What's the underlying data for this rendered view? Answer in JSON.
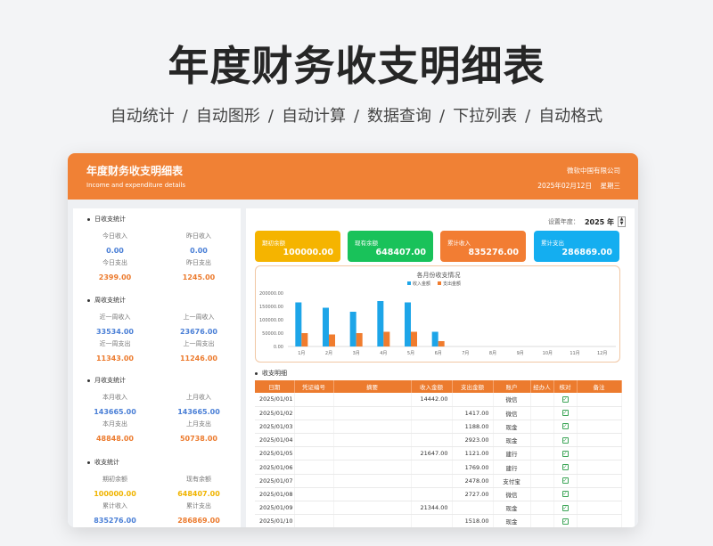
{
  "hero": {
    "title": "年度财务收支明细表",
    "features": [
      "自动统计",
      "自动图形",
      "自动计算",
      "数据查询",
      "下拉列表",
      "自动格式"
    ]
  },
  "header": {
    "title": "年度财务收支明细表",
    "subtitle": "Income and expenditure details",
    "company": "微软中国有限公司",
    "date": "2025年02月12日    星期三"
  },
  "colors": {
    "header_orange": "#f08135",
    "income_blue": "#1da5e8",
    "expense_orange": "#f07c2e",
    "opening_gold": "#f5b400",
    "balance_green": "#19c25a",
    "total_income_orange": "#f27d33",
    "total_expense_blue": "#14aef0"
  },
  "left": {
    "sections": [
      {
        "title": "日收支统计",
        "cells": [
          {
            "label": "今日收入",
            "value": "0.00",
            "color": "blue"
          },
          {
            "label": "昨日收入",
            "value": "0.00",
            "color": "blue"
          },
          {
            "label": "今日支出",
            "value": "2399.00",
            "color": "orange"
          },
          {
            "label": "昨日支出",
            "value": "1245.00",
            "color": "orange"
          }
        ]
      },
      {
        "title": "周收支统计",
        "cells": [
          {
            "label": "近一周收入",
            "value": "33534.00",
            "color": "blue"
          },
          {
            "label": "上一周收入",
            "value": "23676.00",
            "color": "blue"
          },
          {
            "label": "近一周支出",
            "value": "11343.00",
            "color": "orange"
          },
          {
            "label": "上一周支出",
            "value": "11246.00",
            "color": "orange"
          }
        ]
      },
      {
        "title": "月收支统计",
        "cells": [
          {
            "label": "本月收入",
            "value": "143665.00",
            "color": "blue"
          },
          {
            "label": "上月收入",
            "value": "143665.00",
            "color": "blue"
          },
          {
            "label": "本月支出",
            "value": "48848.00",
            "color": "orange"
          },
          {
            "label": "上月支出",
            "value": "50738.00",
            "color": "orange"
          }
        ]
      },
      {
        "title": "收支统计",
        "cells": [
          {
            "label": "期初余额",
            "value": "100000.00",
            "color": "gold"
          },
          {
            "label": "现有余额",
            "value": "648407.00",
            "color": "gold"
          },
          {
            "label": "累计收入",
            "value": "835276.00",
            "color": "blue"
          },
          {
            "label": "累计支出",
            "value": "286869.00",
            "color": "orange"
          }
        ]
      }
    ]
  },
  "year_setter": {
    "label": "设置年度：",
    "value": "2025 年",
    "up": "▲",
    "down": "▼"
  },
  "summary": [
    {
      "label": "期初余额",
      "value": "100000.00",
      "color": "#f5b400"
    },
    {
      "label": "现有余额",
      "value": "648407.00",
      "color": "#19c25a"
    },
    {
      "label": "累计收入",
      "value": "835276.00",
      "color": "#f27d33"
    },
    {
      "label": "累计支出",
      "value": "286869.00",
      "color": "#14aef0"
    }
  ],
  "chart_data": {
    "type": "bar",
    "title": "各月份收支情况",
    "categories": [
      "1月",
      "2月",
      "3月",
      "4月",
      "5月",
      "6月",
      "7月",
      "8月",
      "9月",
      "10月",
      "11月",
      "12月"
    ],
    "series": [
      {
        "name": "收入金额",
        "color": "#1da5e8",
        "values": [
          165000,
          145000,
          130000,
          170000,
          165000,
          55000,
          0,
          0,
          0,
          0,
          0,
          0
        ]
      },
      {
        "name": "支出金额",
        "color": "#f07c2e",
        "values": [
          50000,
          45000,
          50000,
          55000,
          55000,
          20000,
          0,
          0,
          0,
          0,
          0,
          0
        ]
      }
    ],
    "yticks": [
      "0.00",
      "50000.00",
      "100000.00",
      "150000.00",
      "200000.00"
    ],
    "ylim": [
      0,
      200000
    ],
    "legend": "top-center",
    "grid": false
  },
  "detail": {
    "title": "收支明细",
    "columns": [
      "日期",
      "凭证编号",
      "摘要",
      "收入金额",
      "支出金额",
      "账户",
      "经办人",
      "核对",
      "备注"
    ],
    "rows": [
      {
        "date": "2025/01/01",
        "income": "14442.00",
        "expense": "",
        "account": "微信"
      },
      {
        "date": "2025/01/02",
        "income": "",
        "expense": "1417.00",
        "account": "微信"
      },
      {
        "date": "2025/01/03",
        "income": "",
        "expense": "1188.00",
        "account": "现金"
      },
      {
        "date": "2025/01/04",
        "income": "",
        "expense": "2923.00",
        "account": "现金"
      },
      {
        "date": "2025/01/05",
        "income": "21647.00",
        "expense": "1121.00",
        "account": "建行"
      },
      {
        "date": "2025/01/06",
        "income": "",
        "expense": "1769.00",
        "account": "建行"
      },
      {
        "date": "2025/01/07",
        "income": "",
        "expense": "2478.00",
        "account": "支付宝"
      },
      {
        "date": "2025/01/08",
        "income": "",
        "expense": "2727.00",
        "account": "微信"
      },
      {
        "date": "2025/01/09",
        "income": "21344.00",
        "expense": "",
        "account": "现金"
      },
      {
        "date": "2025/01/10",
        "income": "",
        "expense": "1518.00",
        "account": "现金"
      }
    ],
    "check_mark": "✓"
  }
}
